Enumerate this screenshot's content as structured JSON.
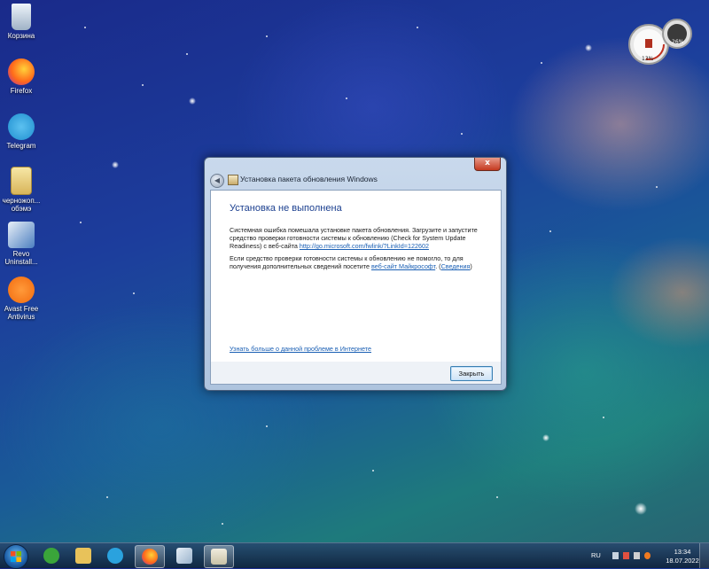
{
  "desktop": {
    "icons": [
      {
        "label": "Корзина",
        "icon": "recycle-bin-icon"
      },
      {
        "label": "Firefox",
        "icon": "firefox-icon"
      },
      {
        "label": "Telegram",
        "icon": "telegram-icon"
      },
      {
        "label": "черножоп... обэмэ",
        "icon": "folder-icon"
      },
      {
        "label": "Revo Uninstall...",
        "icon": "revo-uninstaller-icon"
      },
      {
        "label": "Avast Free Antivirus",
        "icon": "avast-icon"
      }
    ],
    "gadget": {
      "cpu": "13%",
      "ram": "26%"
    }
  },
  "dialog": {
    "title": "Установка пакета обновления Windows",
    "heading": "Установка не выполнена",
    "paragraph1": "Системная ошибка помешала установке пакета обновления. Загрузите и запустите средство проверки готовности системы к обновлению (Check for System Update Readiness) с веб-сайта",
    "link1": "http://go.microsoft.com/fwlink/?LinkId=122602",
    "paragraph2": "Если средство проверки готовности системы к обновлению не помогло, то для получения дополнительных сведений посетите",
    "link2": "веб-сайт Майкрософт",
    "link3": "Сведения",
    "more_link": "Узнать больше о данной проблеме в Интернете",
    "close_button": "Закрыть",
    "close_x": "x"
  },
  "taskbar": {
    "apps": [
      {
        "name": "utorrent",
        "icon": "utorrent-icon",
        "color": "#3aa53a"
      },
      {
        "name": "explorer",
        "icon": "folder-icon",
        "color": "#e8c25a"
      },
      {
        "name": "telegram",
        "icon": "telegram-icon",
        "color": "#2aa2de"
      },
      {
        "name": "firefox",
        "icon": "firefox-icon",
        "color": "#ff7a1a"
      },
      {
        "name": "paint",
        "icon": "paint-icon",
        "color": "#c9d8e6"
      },
      {
        "name": "update-installer",
        "icon": "installer-icon",
        "color": "#d8d4c6"
      }
    ],
    "lang": "RU",
    "time": "13:34",
    "date": "18.07.2022"
  }
}
